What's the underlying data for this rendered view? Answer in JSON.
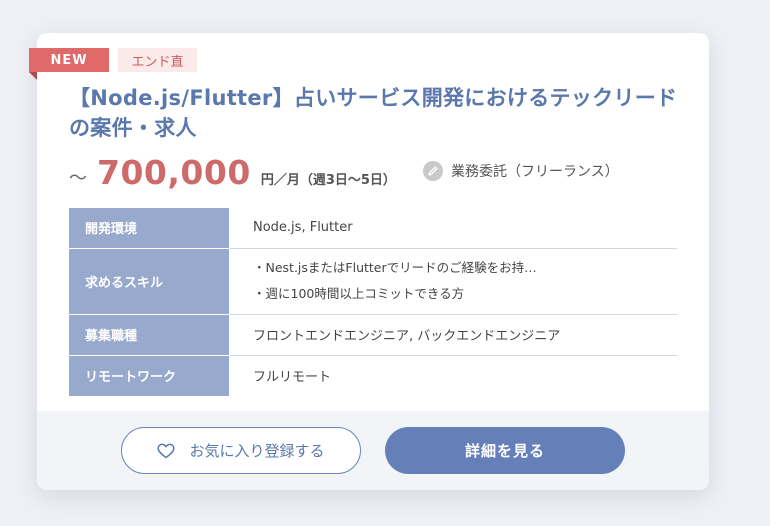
{
  "card": {
    "badge_new": "NEW",
    "tag": "エンド直",
    "title": "【Node.js/Flutter】占いサービス開発におけるテックリードの案件・求人",
    "salary": {
      "prefix": "～",
      "amount": "700,000",
      "unit": "円／月（週3日～5日）"
    },
    "contract": {
      "icon": "pencil-icon",
      "label": "業務委託（フリーランス）"
    },
    "table": {
      "dev_env_label": "開発環境",
      "dev_env_value": "Node.js, Flutter",
      "skills_label": "求めるスキル",
      "skills": [
        "・Nest.jsまたはFlutterでリードのご経験をお持…",
        "・週に100時間以上コミットできる方"
      ],
      "position_label": "募集職種",
      "position_value": "フロントエンドエンジニア, バックエンドエンジニア",
      "remote_label": "リモートワーク",
      "remote_value": "フルリモート"
    },
    "buttons": {
      "favorite": "お気に入り登録する",
      "detail": "詳細を見る"
    }
  },
  "colors": {
    "accent": "#5b78ac",
    "salary": "#cf6a6a",
    "badge_new": "#e06a6a",
    "table_header": "#97a9cd",
    "detail_button": "#6580b8"
  }
}
